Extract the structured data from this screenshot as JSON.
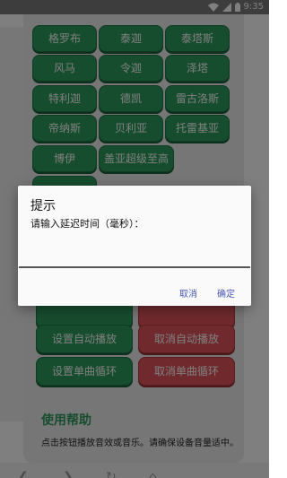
{
  "status_bar": {
    "time": "9:35"
  },
  "top_grid": [
    "格罗布",
    "泰迦",
    "泰塔斯",
    "风马",
    "令迦",
    "泽塔",
    "特利迦",
    "德凯",
    "雷古洛斯",
    "帝纳斯",
    "贝利亚",
    "托雷基亚",
    "博伊",
    "盖亚超级至高",
    ""
  ],
  "controls": {
    "set_auto_play": "设置自动播放",
    "cancel_auto_play": "取消自动播放",
    "set_single_loop": "设置单曲循环",
    "cancel_single_loop": "取消单曲循环"
  },
  "help": {
    "title": "使用帮助",
    "text": "点击按钮播放音效或音乐。请确保设备音量适中。"
  },
  "dialog": {
    "title": "提示",
    "message": "请输入延迟时间（毫秒）：",
    "input_value": "",
    "cancel_label": "取消",
    "confirm_label": "确定"
  },
  "colors": {
    "green_button": "#2e9b5e",
    "red_button": "#e0555a",
    "dialog_action": "#4a58b5"
  }
}
